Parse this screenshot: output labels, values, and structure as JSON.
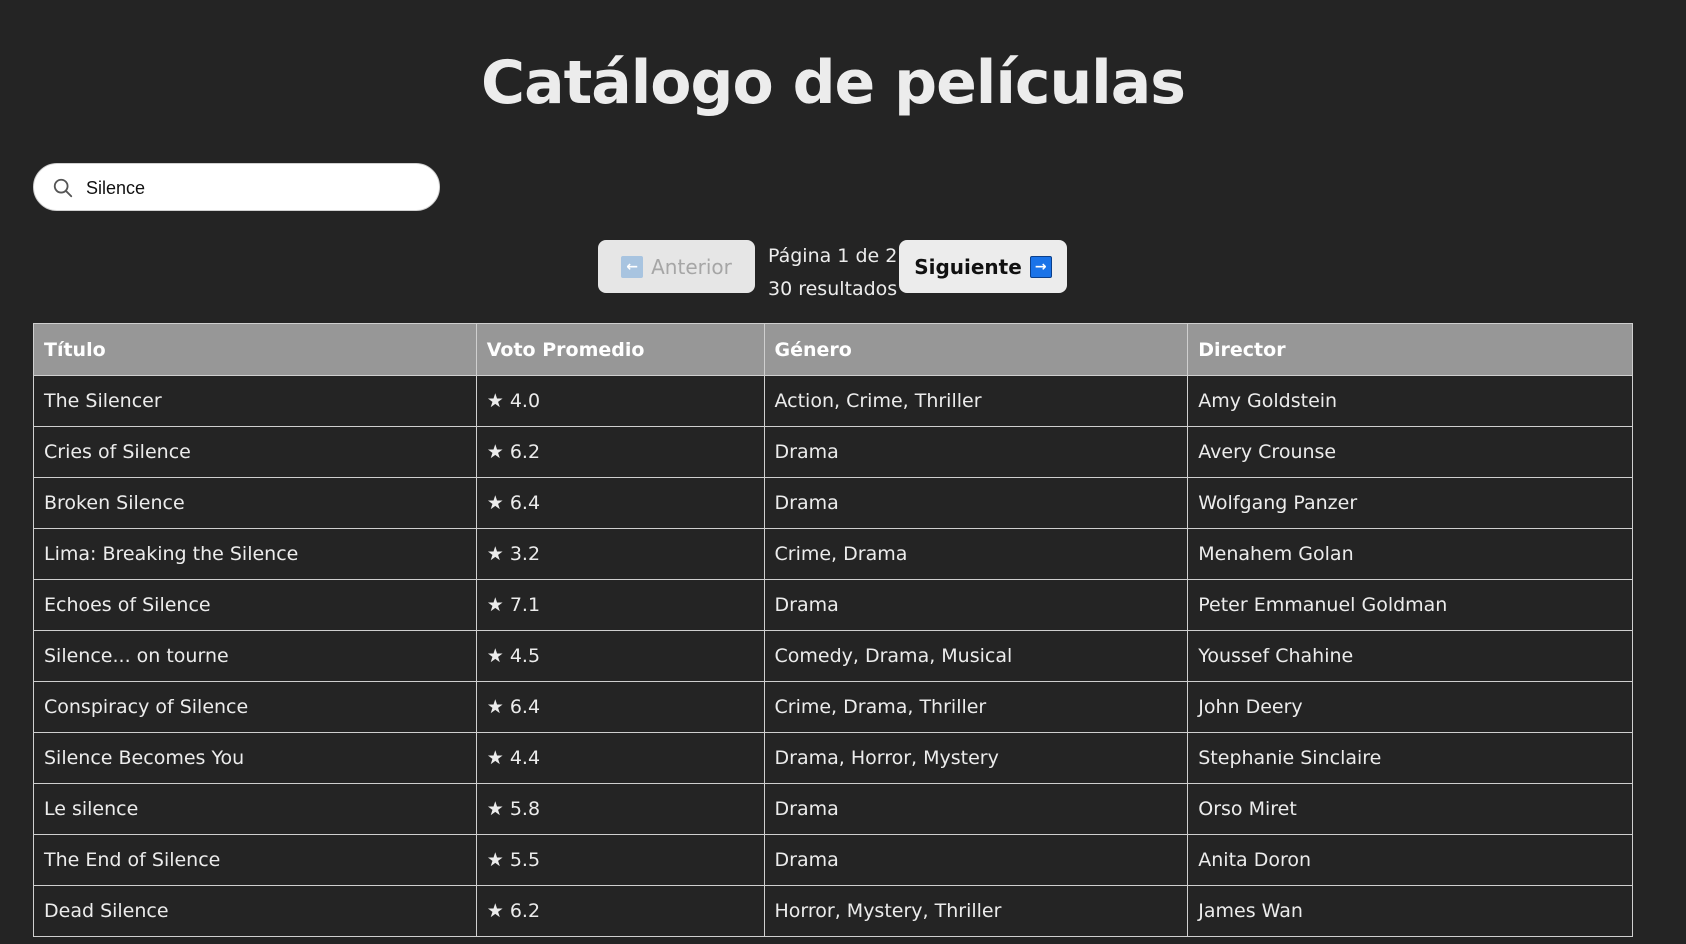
{
  "page": {
    "title": "Catálogo de películas"
  },
  "search": {
    "value": "Silence",
    "icon": "search-icon"
  },
  "pagination": {
    "prev_label": "Anterior",
    "prev_arrow": "←",
    "next_label": "Siguiente",
    "next_arrow": "→",
    "page_text": "Página 1 de 2",
    "results_text": "30 resultados",
    "prev_disabled": true
  },
  "table": {
    "columns": [
      "Título",
      "Voto Promedio",
      "Género",
      "Director"
    ],
    "rows": [
      {
        "title": "The Silencer",
        "vote": "★ 4.0",
        "genre": "Action, Crime, Thriller",
        "director": "Amy Goldstein"
      },
      {
        "title": "Cries of Silence",
        "vote": "★ 6.2",
        "genre": "Drama",
        "director": "Avery Crounse"
      },
      {
        "title": "Broken Silence",
        "vote": "★ 6.4",
        "genre": "Drama",
        "director": "Wolfgang Panzer"
      },
      {
        "title": "Lima: Breaking the Silence",
        "vote": "★ 3.2",
        "genre": "Crime, Drama",
        "director": "Menahem Golan"
      },
      {
        "title": "Echoes of Silence",
        "vote": "★ 7.1",
        "genre": "Drama",
        "director": "Peter Emmanuel Goldman"
      },
      {
        "title": "Silence... on tourne",
        "vote": "★ 4.5",
        "genre": "Comedy, Drama, Musical",
        "director": "Youssef Chahine"
      },
      {
        "title": "Conspiracy of Silence",
        "vote": "★ 6.4",
        "genre": "Crime, Drama, Thriller",
        "director": "John Deery"
      },
      {
        "title": "Silence Becomes You",
        "vote": "★ 4.4",
        "genre": "Drama, Horror, Mystery",
        "director": "Stephanie Sinclaire"
      },
      {
        "title": "Le silence",
        "vote": "★ 5.8",
        "genre": "Drama",
        "director": "Orso Miret"
      },
      {
        "title": "The End of Silence",
        "vote": "★ 5.5",
        "genre": "Drama",
        "director": "Anita Doron"
      },
      {
        "title": "Dead Silence",
        "vote": "★ 6.2",
        "genre": "Horror, Mystery, Thriller",
        "director": "James Wan"
      }
    ]
  },
  "colors": {
    "background": "#242424",
    "header_bg": "#979797",
    "border": "#cfcfcf",
    "accent": "#1a73e8"
  }
}
